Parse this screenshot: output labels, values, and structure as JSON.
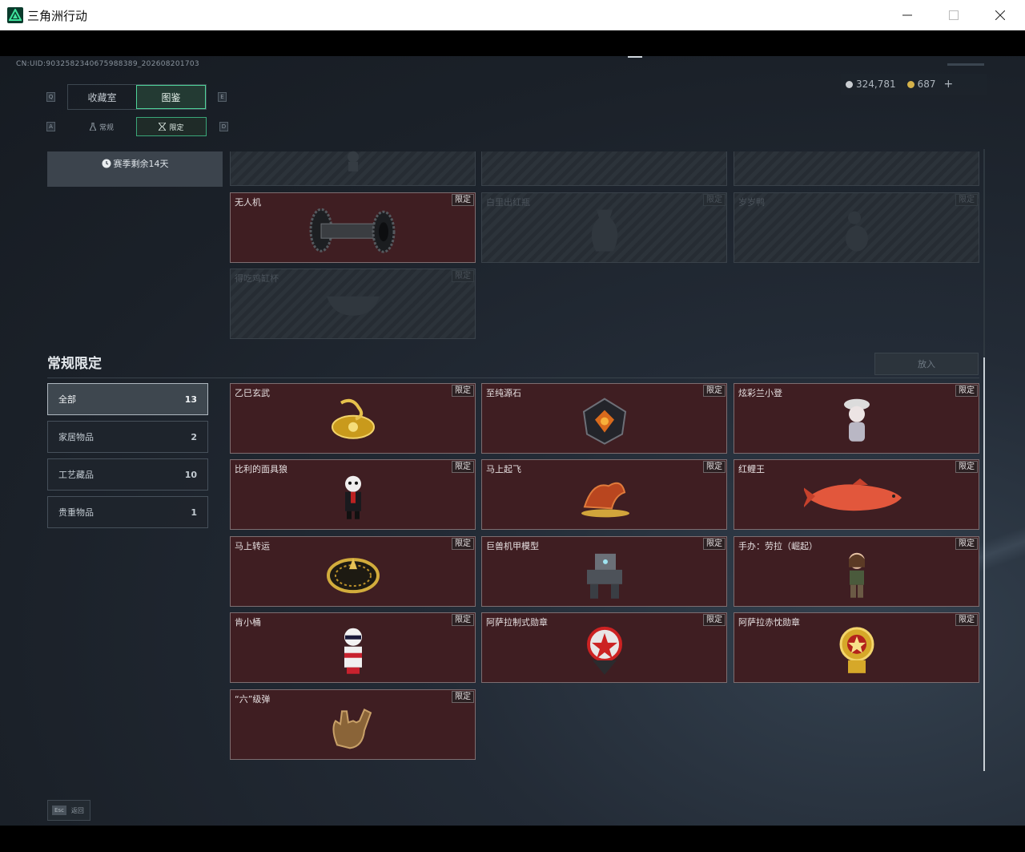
{
  "window": {
    "title": "三角洲行动"
  },
  "header": {
    "uid": "CN:UID:9032582340675988389_202608201703"
  },
  "currency": {
    "silver": "324,781",
    "gold": "687",
    "add": "+"
  },
  "keys": {
    "q": "Q",
    "e": "E",
    "a": "A",
    "d": "D"
  },
  "tabs": {
    "primary": [
      "收藏室",
      "图鉴"
    ],
    "secondary": [
      "常规",
      "限定"
    ]
  },
  "season": {
    "remaining": "赛季剩余14天"
  },
  "top_cards": [
    {
      "name": "",
      "tag": ""
    },
    {
      "name": "",
      "tag": ""
    },
    {
      "name": "",
      "tag": ""
    },
    {
      "name": "无人机",
      "tag": "限定"
    },
    {
      "name": "白里出红瓶",
      "tag": "限定"
    },
    {
      "name": "岁岁鸭",
      "tag": "限定"
    },
    {
      "name": "得吃鸡缸杯",
      "tag": "限定"
    }
  ],
  "section": {
    "title": "常规限定",
    "sort_label": "放入"
  },
  "categories": [
    {
      "label": "全部",
      "count": "13"
    },
    {
      "label": "家居物品",
      "count": "2"
    },
    {
      "label": "工艺藏品",
      "count": "10"
    },
    {
      "label": "贵重物品",
      "count": "1"
    }
  ],
  "cards": [
    {
      "name": "乙巳玄武",
      "tag": "限定"
    },
    {
      "name": "至纯源石",
      "tag": "限定"
    },
    {
      "name": "炫彩兰小登",
      "tag": "限定"
    },
    {
      "name": "比利的面具狼",
      "tag": "限定"
    },
    {
      "name": "马上起飞",
      "tag": "限定"
    },
    {
      "name": "红鲤王",
      "tag": "限定"
    },
    {
      "name": "马上转运",
      "tag": "限定"
    },
    {
      "name": "巨兽机甲模型",
      "tag": "限定"
    },
    {
      "name": "手办：劳拉（崛起）",
      "tag": "限定"
    },
    {
      "name": "肯小桶",
      "tag": "限定"
    },
    {
      "name": "阿萨拉制式勋章",
      "tag": "限定"
    },
    {
      "name": "阿萨拉赤忱勋章",
      "tag": "限定"
    },
    {
      "name": "“六”级弹",
      "tag": "限定"
    }
  ],
  "footer": {
    "esc": "Esc",
    "back": "返回"
  },
  "colors": {
    "accent": "#4fd39a",
    "card_owned": "#3f1e22"
  }
}
